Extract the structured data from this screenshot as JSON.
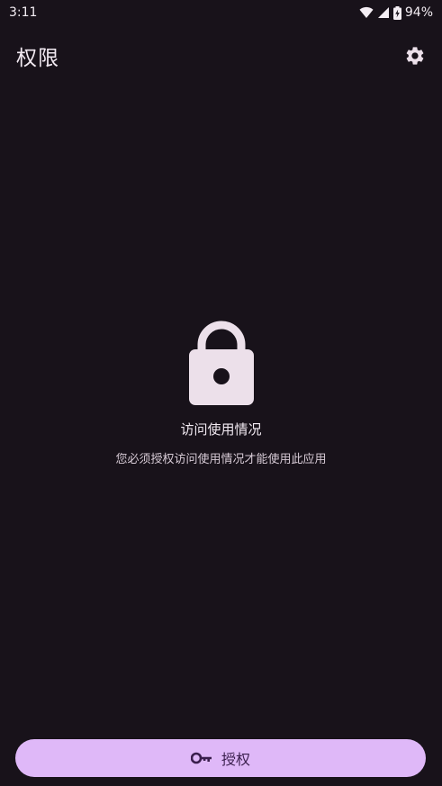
{
  "status_bar": {
    "time": "3:11",
    "battery": "94%"
  },
  "app_bar": {
    "title": "权限",
    "settings_icon": "gear-icon"
  },
  "permission": {
    "icon": "lock-icon",
    "headline": "访问使用情况",
    "description": "您必须授权访问使用情况才能使用此应用"
  },
  "grant_button": {
    "icon": "key-icon",
    "label": "授权"
  },
  "colors": {
    "background": "#18121a",
    "accent": "#dfb8f8",
    "icon": "#ece0ea"
  }
}
